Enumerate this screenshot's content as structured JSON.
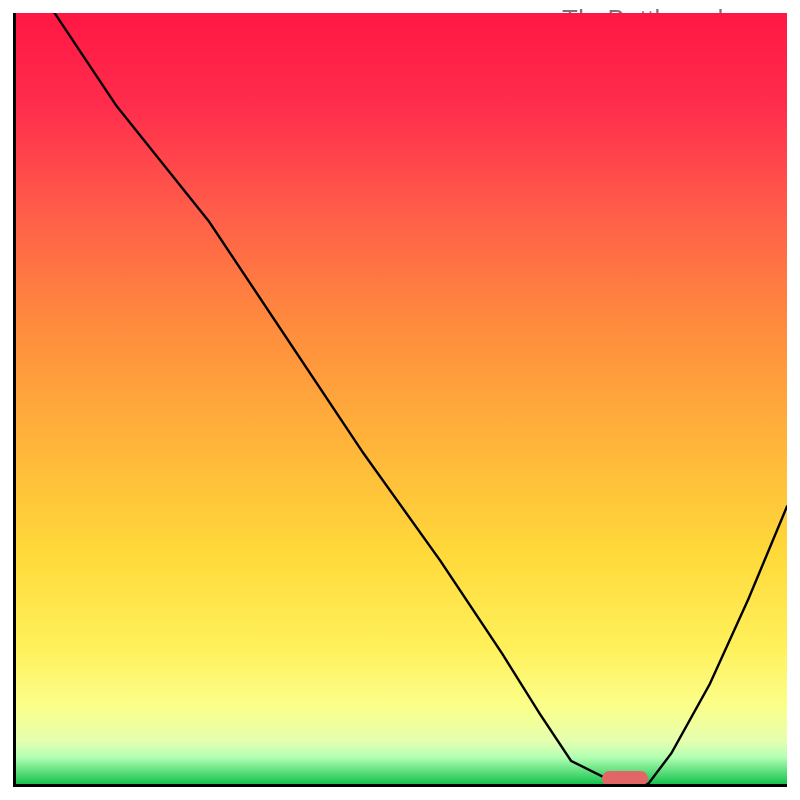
{
  "watermark": "TheBottleneck.com",
  "chart_data": {
    "type": "line",
    "title": "",
    "xlabel": "",
    "ylabel": "",
    "xlim": [
      0,
      100
    ],
    "ylim": [
      0,
      100
    ],
    "x": [
      0,
      5,
      13,
      25,
      35,
      45,
      55,
      63,
      68,
      72,
      78,
      82,
      85,
      90,
      95,
      100
    ],
    "values": [
      108,
      100,
      88,
      73,
      58,
      43,
      29,
      17,
      9,
      3,
      0,
      0,
      4,
      13,
      24,
      36
    ],
    "background_gradient": {
      "stops": [
        {
          "pos": 0.0,
          "color": "#ff1744"
        },
        {
          "pos": 0.12,
          "color": "#ff2d4c"
        },
        {
          "pos": 0.25,
          "color": "#ff5a4a"
        },
        {
          "pos": 0.4,
          "color": "#ff8a3e"
        },
        {
          "pos": 0.55,
          "color": "#ffb23a"
        },
        {
          "pos": 0.7,
          "color": "#ffd93a"
        },
        {
          "pos": 0.82,
          "color": "#fff05a"
        },
        {
          "pos": 0.9,
          "color": "#fbff8a"
        },
        {
          "pos": 0.945,
          "color": "#e4ffb0"
        },
        {
          "pos": 0.965,
          "color": "#b3ffb3"
        },
        {
          "pos": 0.98,
          "color": "#6fe688"
        },
        {
          "pos": 1.0,
          "color": "#17c24e"
        }
      ]
    },
    "marker": {
      "x": 79,
      "y": 0.7,
      "w": 6,
      "h": 2,
      "color": "#e36666"
    }
  }
}
